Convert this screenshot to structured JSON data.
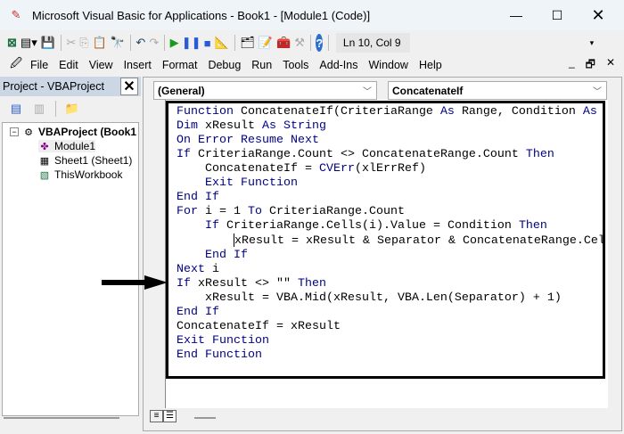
{
  "window": {
    "title": "Microsoft Visual Basic for Applications - Book1 - [Module1 (Code)]"
  },
  "toolbar": {
    "status": "Ln 10, Col 9"
  },
  "menu": [
    "File",
    "Edit",
    "View",
    "Insert",
    "Format",
    "Debug",
    "Run",
    "Tools",
    "Add-Ins",
    "Window",
    "Help"
  ],
  "project": {
    "title": "Project - VBAProject",
    "root": "VBAProject (Book1",
    "items": [
      "Module1",
      "Sheet1 (Sheet1)",
      "ThisWorkbook"
    ]
  },
  "code": {
    "object_dropdown": "(General)",
    "procedure_dropdown": "ConcatenateIf",
    "lines": [
      [
        [
          "Function ",
          "kw"
        ],
        [
          "ConcatenateIf(CriteriaRange ",
          "id"
        ],
        [
          "As ",
          "kw"
        ],
        [
          "Range, Condition ",
          "id"
        ],
        [
          "As",
          "kw"
        ]
      ],
      [
        [
          "Dim ",
          "kw"
        ],
        [
          "xResult ",
          "id"
        ],
        [
          "As String",
          "kw"
        ]
      ],
      [
        [
          "On Error Resume Next",
          "kw"
        ]
      ],
      [
        [
          "If ",
          "kw"
        ],
        [
          "CriteriaRange.Count <> ConcatenateRange.Count ",
          "id"
        ],
        [
          "Then",
          "kw"
        ]
      ],
      [
        [
          "    ConcatenateIf = ",
          "id"
        ],
        [
          "CVErr",
          "kw"
        ],
        [
          "(xlErrRef)",
          "id"
        ]
      ],
      [
        [
          "    Exit Function",
          "kw"
        ]
      ],
      [
        [
          "End If",
          "kw"
        ]
      ],
      [
        [
          "For ",
          "kw"
        ],
        [
          "i = 1 ",
          "id"
        ],
        [
          "To ",
          "kw"
        ],
        [
          "CriteriaRange.Count",
          "id"
        ]
      ],
      [
        [
          "    If ",
          "kw"
        ],
        [
          "CriteriaRange.Cells(i).Value = Condition ",
          "id"
        ],
        [
          "Then",
          "kw"
        ]
      ],
      [
        [
          "        ",
          "id"
        ],
        [
          "|",
          "cursor"
        ],
        [
          "xResult = xResult & Separator & ConcatenateRange.Cel",
          "id"
        ]
      ],
      [
        [
          "    End If",
          "kw"
        ]
      ],
      [
        [
          "Next ",
          "kw"
        ],
        [
          "i",
          "id"
        ]
      ],
      [
        [
          "If ",
          "kw"
        ],
        [
          "xResult <> \"\" ",
          "id"
        ],
        [
          "Then",
          "kw"
        ]
      ],
      [
        [
          "    xResult = VBA.Mid(xResult, VBA.Len(Separator) + 1)",
          "id"
        ]
      ],
      [
        [
          "End If",
          "kw"
        ]
      ],
      [
        [
          "ConcatenateIf = xResult",
          "id"
        ]
      ],
      [
        [
          "Exit Function",
          "kw"
        ]
      ],
      [
        [
          "End Function",
          "kw"
        ]
      ]
    ]
  }
}
